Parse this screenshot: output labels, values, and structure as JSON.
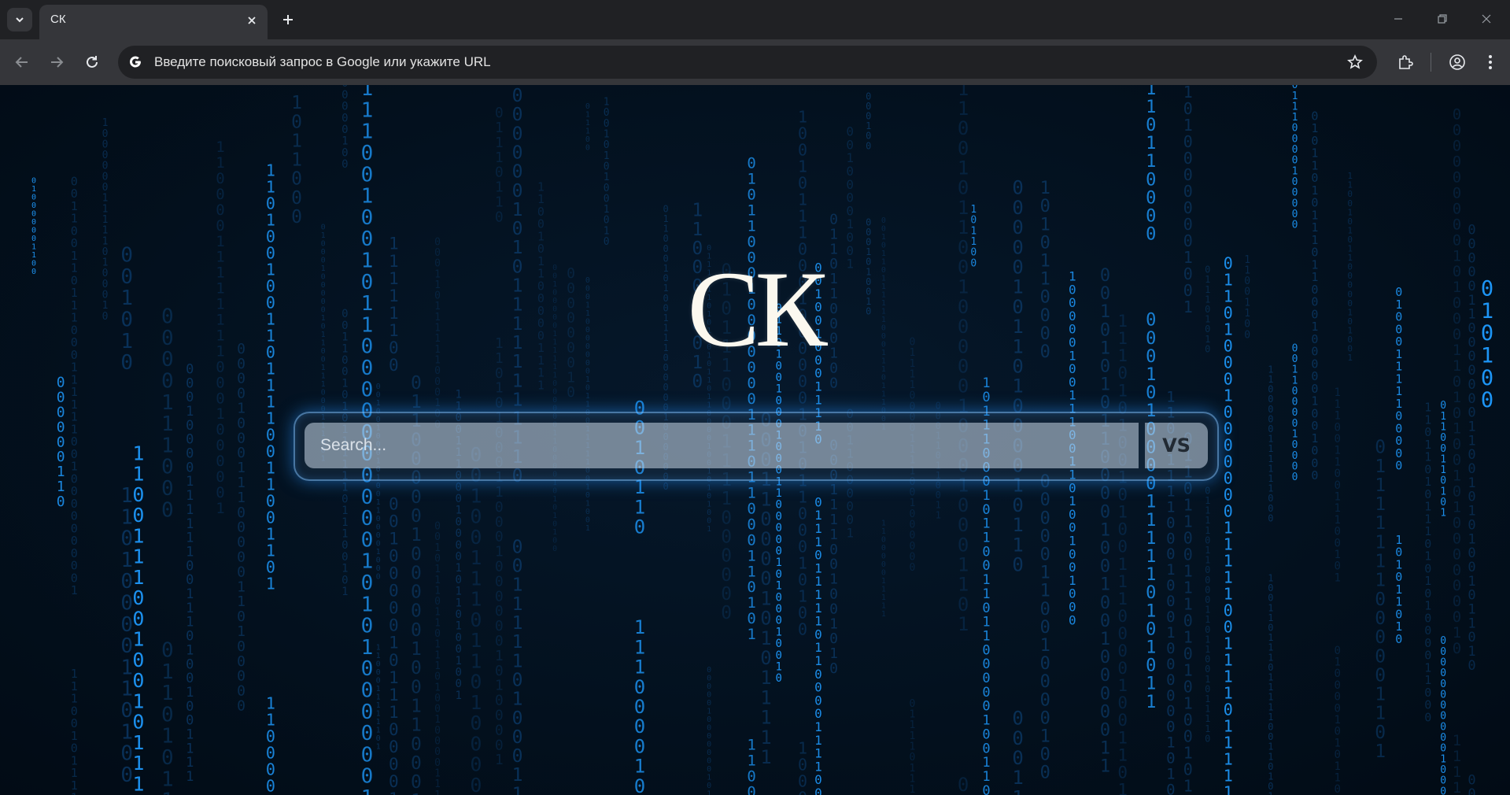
{
  "browser": {
    "tab_title": "СК",
    "address_placeholder": "Введите поисковый запрос в Google или укажите URL"
  },
  "page": {
    "logo": "СК",
    "search_placeholder": "Search...",
    "search_button": "VS"
  },
  "colors": {
    "background": "#03101d",
    "rain_bright": "#1e9bff",
    "rain_dim": "#0d3f70",
    "logo": "#fbf8ef"
  },
  "icons": [
    "tab-search-icon",
    "close-icon",
    "plus-icon",
    "minimize-icon",
    "restore-icon",
    "back-icon",
    "forward-icon",
    "reload-icon",
    "google-icon",
    "star-icon",
    "extensions-icon",
    "profile-icon",
    "menu-icon"
  ]
}
